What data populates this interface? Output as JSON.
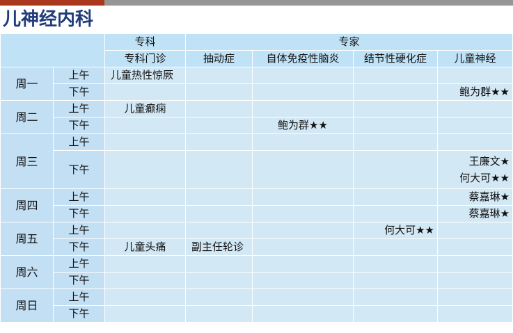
{
  "page": {
    "title": "儿神经内科"
  },
  "header": {
    "group_specialty": "专科",
    "group_expert": "专家",
    "col_specialty_clinic": "专科门诊",
    "col_tic": "抽动症",
    "col_autoimmune": "自体免疫性脑炎",
    "col_tuberous": "结节性硬化症",
    "col_child_neuro": "儿童神经"
  },
  "days": [
    {
      "name": "周一",
      "am": "上午",
      "pm": "下午",
      "am_specialty": "儿童热性惊厥",
      "pm_child_neuro": "鲍为群★★"
    },
    {
      "name": "周二",
      "am": "上午",
      "pm": "下午",
      "am_specialty": "儿童癫痫",
      "pm_autoimmune": "鲍为群★★"
    },
    {
      "name": "周三",
      "am": "上午",
      "pm": "下午",
      "pm_child_neuro_1": "王廉文★",
      "pm_child_neuro_2": "何大可★★"
    },
    {
      "name": "周四",
      "am": "上午",
      "pm": "下午",
      "am_child_neuro": "蔡嘉琳★",
      "pm_child_neuro": "蔡嘉琳★"
    },
    {
      "name": "周五",
      "am": "上午",
      "pm": "下午",
      "am_tuberous": "何大可★★",
      "pm_specialty": "儿童头痛",
      "pm_tic": "副主任轮诊"
    },
    {
      "name": "周六",
      "am": "上午",
      "pm": "下午"
    },
    {
      "name": "周日",
      "am": "上午",
      "pm": "下午"
    }
  ]
}
